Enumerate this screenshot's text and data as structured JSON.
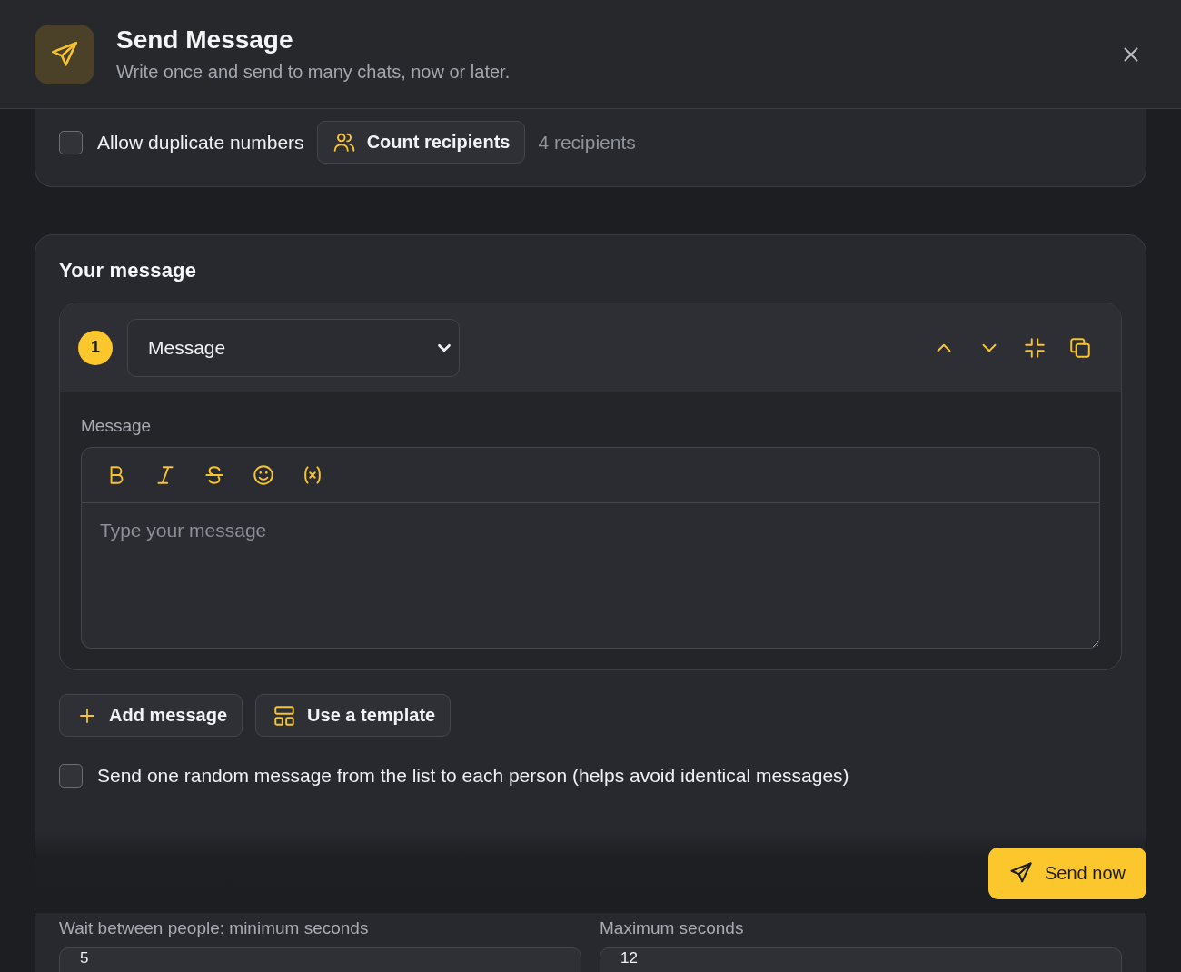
{
  "header": {
    "title": "Send Message",
    "subtitle": "Write once and send to many chats, now or later."
  },
  "recipients": {
    "allow_duplicates": {
      "label": "Allow duplicate numbers",
      "checked": false
    },
    "count_button": "Count recipients",
    "count": "4 recipients"
  },
  "message_section": {
    "title": "Your message",
    "messages": [
      {
        "number": "1",
        "type": "Message",
        "field_label": "Message",
        "placeholder": "Type your message"
      }
    ],
    "add_button": "Add message",
    "template_button": "Use a template",
    "random": {
      "label": "Send one random message from the list to each person (helps avoid identical messages)",
      "checked": false
    }
  },
  "delay": {
    "fields": [
      {
        "label": "Wait between people: minimum seconds",
        "value": "5"
      },
      {
        "label": "Maximum seconds",
        "value": "12"
      }
    ]
  },
  "send_button": "Send now"
}
